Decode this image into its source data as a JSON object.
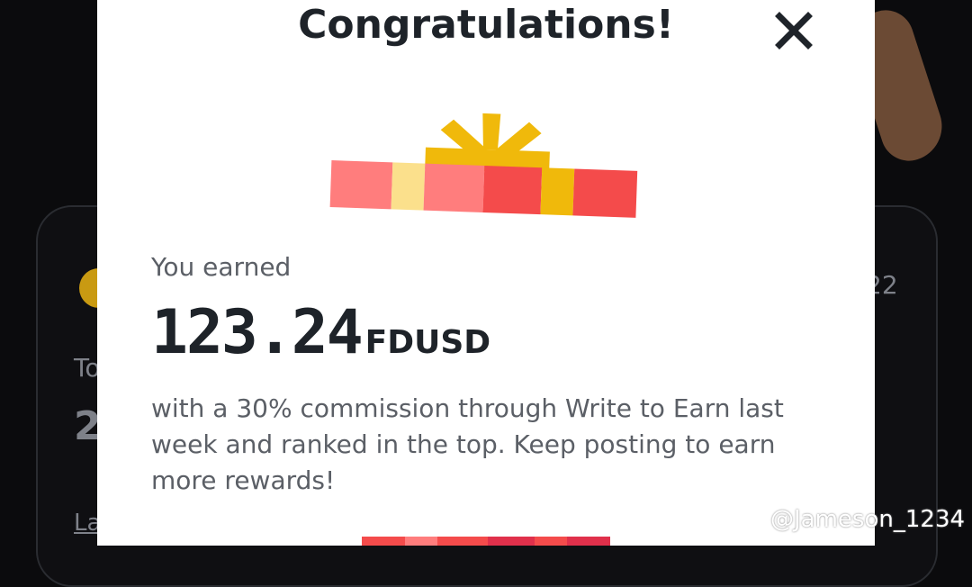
{
  "background": {
    "partial_text_to": "To",
    "partial_text_two": "2",
    "partial_text_la": "La",
    "partial_text_num": "22"
  },
  "modal": {
    "title": "Congratulations!",
    "close_icon": "close-icon",
    "gift_icon": "gift-icon",
    "earned_label": "You earned",
    "amount_value": "123.24",
    "amount_unit": "FDUSD",
    "description": "with a 30% commission through Write to Earn last week and ranked in the top. Keep posting to earn more rewards!"
  },
  "watermark": {
    "text": "@Jameson_1234",
    "icon": "binance-logo-icon"
  },
  "colors": {
    "primary_text": "#1e2329",
    "secondary_text": "#5b5f66",
    "gift_gold": "#f0b90b",
    "gift_red": "#f44b4b",
    "gift_pink": "#ff7d7d"
  }
}
